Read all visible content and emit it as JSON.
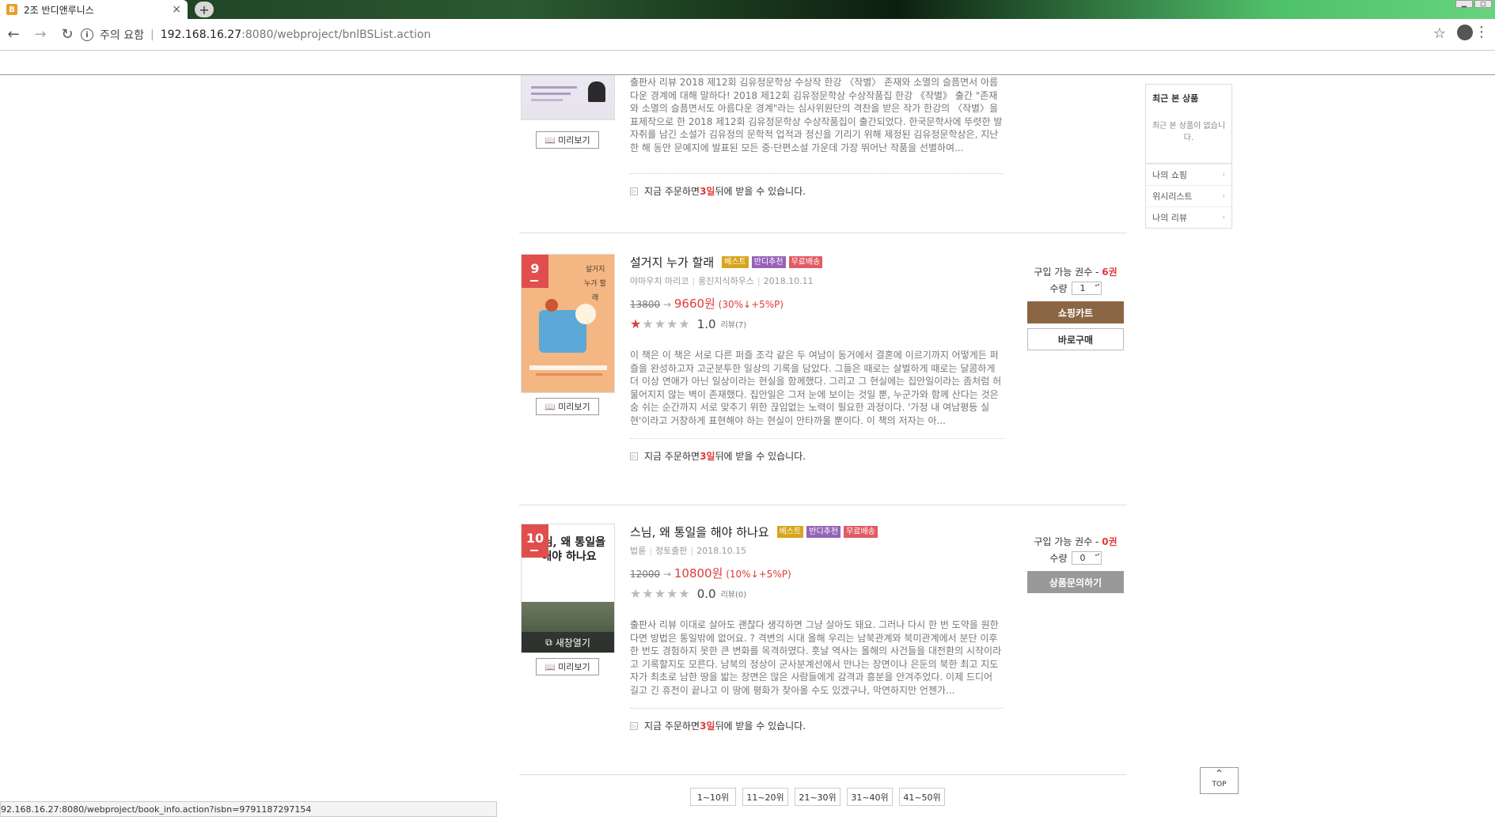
{
  "browser": {
    "tab_favicon": "B",
    "tab_title": "2조 반디앤루니스",
    "tab_close": "×",
    "new_tab": "+",
    "security_label": "주의 요함",
    "url_host": "192.168.16.27",
    "url_rest": ":8080/webproject/bnlBSList.action",
    "status_url": "92.168.16.27:8080/webproject/book_info.action?isbn=9791187297154"
  },
  "book1": {
    "desc": "출판사 리뷰 2018 제12회 김유정문학상 수상작 한강 〈작별〉 존재와 소멸의 슬픔면서 아름다운 경계에 대해 말하다! 2018 제12회 김유정문학상 수상작품집 한강 《작별》 출간 \"존재와 소멸의 슬픔면서도 아름다운 경계\"라는 심사위원단의 격찬을 받은 작가 한강의 〈작별〉을 표제작으로 한 2018 제12회 김유정문학상 수상작품집이 출간되었다. 한국문학사에 뚜렷한 발자취를 남긴 소설가 김유정의 문학적 업적과 정신을 기리기 위해 제정된 김유정문학상은, 지난 한 해 동안 문예지에 발표된 모든 중·단편소설 가운데 가장 뛰어난 작품을 선별하여...",
    "preview": "미리보기",
    "ship_pre": "지금 주문하면 ",
    "ship_days": "3일",
    "ship_post": " 뒤에 받을 수 있습니다."
  },
  "book2": {
    "rank": "9",
    "cover_title": "설거지 누가 할래",
    "title": "설거지 누가 할래",
    "badges": [
      "베스트",
      "반디추천",
      "무료배송"
    ],
    "author": "야마우치 마리코",
    "publisher": "웅진지식하우스",
    "date": "2018.10.11",
    "orig_price": "13800",
    "arrow": " → ",
    "sale_price": "9660원",
    "discount": " (30%↓+5%P)",
    "score": "1.0",
    "reviews": "리뷰(7)",
    "rating_value": 1,
    "desc": "이 책은 이 책은 서로 다른 퍼즐 조각 같은 두 여남이 동거에서 결혼에 이르기까지 어떻게든 퍼즐을 완성하고자 고군분투한 일상의 기록을 담았다. 그들은 때로는 살벌하게 때로는 달콤하게 더 이상 연애가 아닌 일상이라는 현실을 함께했다. 그리고 그 현실에는 집안일이라는 좀처럼 허물어지지 않는 벽이 존재했다. 집안일은 그저 눈에 보이는 것일 뿐, 누군가와 함께 산다는 것은 숨 쉬는 순간까지 서로 맞추기 위한 끊임없는 노력이 필요한 과정이다. '가정 내 여남평등 실현'이라고 거창하게 표현해야 하는 현실이 안타까울 뿐이다. 이 책의 저자는 아...",
    "preview": "미리보기",
    "ship_pre": "지금 주문하면 ",
    "ship_days": "3일",
    "ship_post": " 뒤에 받을 수 있습니다.",
    "avail_pre": "구입 가능 권수 - ",
    "avail_num": "6권",
    "qty_label": "수량",
    "qty_value": "1",
    "cart_btn": "쇼핑카트",
    "buy_btn": "바로구매"
  },
  "book3": {
    "rank": "10",
    "cover_title": "스님, 왜 통일을 해야 하나요",
    "title": "스님, 왜 통일을 해야 하나요",
    "badges": [
      "베스트",
      "반디추천",
      "무료배송"
    ],
    "author": "법륜",
    "publisher": "정토출판",
    "date": "2018.10.15",
    "orig_price": "12000",
    "arrow": " → ",
    "sale_price": "10800원",
    "discount": " (10%↓+5%P)",
    "score": "0.0",
    "reviews": "리뷰(0)",
    "rating_value": 0,
    "new_window": "새창열기",
    "desc": "출판사 리뷰 이대로 살아도 괜찮다 생각하면 그냥 살아도 돼요. 그러나 다시 한 번 도약을 원한다면 방법은 통일밖에 없어요. ? 격변의 시대 올해 우리는 남북관계와 북미관계에서 분단 이후 한 번도 경험하지 못한 큰 변화를 목격하였다. 훗날 역사는 올해의 사건들을 대전환의 시작이라고 기록할지도 모른다. 남북의 정상이 군사분계선에서 만나는 장면이나 은둔의 북한 최고 지도자가 최초로 남한 땅을 밟는 장면은 많은 사람들에게 감격과 흥분을 안겨주었다. 이제 드디어 길고 긴 휴전이 끝나고 이 땅에 평화가 찾아올 수도 있겠구나, 막연하지만 언젠가...",
    "preview": "미리보기",
    "ship_pre": "지금 주문하면 ",
    "ship_days": "3일",
    "ship_post": " 뒤에 받을 수 있습니다.",
    "avail_pre": "구입 가능 권수 - ",
    "avail_num": "0권",
    "qty_label": "수량",
    "qty_value": "0",
    "inquiry_btn": "상품문의하기"
  },
  "recent": {
    "title": "최근 본 상품",
    "empty": "최근 본 상품이 없습니다.",
    "links": [
      "나의 쇼핑",
      "위시리스트",
      "나의 리뷰"
    ]
  },
  "pagination": [
    "1~10위",
    "11~20위",
    "21~30위",
    "31~40위",
    "41~50위"
  ],
  "top_button": "TOP",
  "colors": {
    "accent_red": "#e03a3a",
    "cart_brown": "#8b6644",
    "rank_red": "#e04e4e"
  }
}
